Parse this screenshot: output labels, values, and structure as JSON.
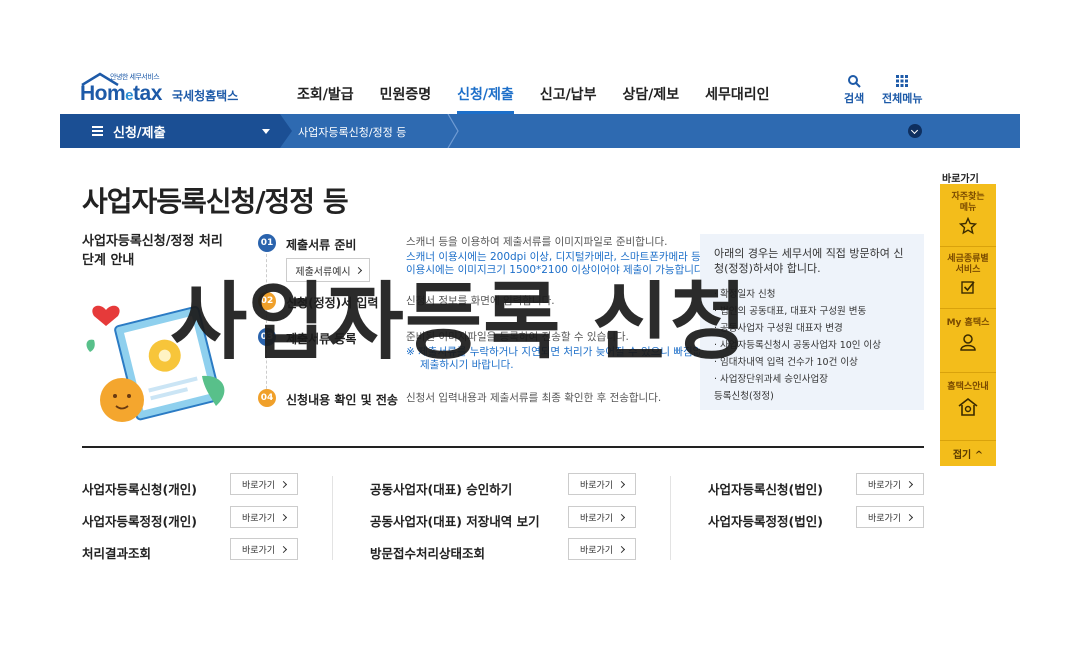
{
  "header": {
    "logo_small": "안녕한 세무서비스",
    "logo_main": "Hometax",
    "logo_sub": "국세청홈택스",
    "nav": [
      "조회/발급",
      "민원증명",
      "신청/제출",
      "신고/납부",
      "상담/제보",
      "세무대리인"
    ],
    "active_nav": "신청/제출",
    "search_label": "검색",
    "menu_label": "전체메뉴"
  },
  "navbar": {
    "category": "신청/제출",
    "current": "사업자등록신청/정정 등"
  },
  "main": {
    "title": "사업자등록신청/정정 등",
    "guide_title": "사업자등록신청/정정 처리단계 안내",
    "steps": [
      {
        "num": "01",
        "title": "제출서류 준비",
        "desc": [
          "스캐너 등을 이용하여 제출서류를 이미지파일로 준비합니다.",
          "스캐너 이용시에는 200dpi 이상, 디지털카메라, 스마트폰카메라 등을",
          "이용시에는 이미지크기 1500*2100 이상이어야 제출이 가능합니다."
        ]
      },
      {
        "num": "02",
        "title": "신청(정정)서 입력",
        "desc": [
          "신청서 정보를 화면에 입력합니다."
        ]
      },
      {
        "num": "03",
        "title": "제출서류 등록",
        "desc": [
          "준비된 이미지파일을 등록하여 전송할 수 있습니다.",
          "※ 제출서류를 누락하거나 지연되면 처리가 늦어질 수 있으니 빠짐없이",
          "제출하시기 바랍니다."
        ]
      },
      {
        "num": "04",
        "title": "신청내용 확인 및 전송",
        "desc": [
          "신청서 입력내용과 제출서류를 최종 확인한 후 전송합니다."
        ]
      }
    ],
    "sample_button": "제출서류예시",
    "notice_title": "아래의 경우는 세무서에 직접 방문하여 신청(정정)하셔야 합니다.",
    "notice_items": [
      "· 확정일자 신청",
      "· 법인의 공동대표, 대표자 구성원 변동",
      "· 공동사업자 구성원 대표자 변경",
      "· 사업자등록신청시 공동사업자 10인 이상",
      "· 임대차내역 입력 건수가 10건 이상",
      "· 사업장단위과세 승인사업장",
      "  등록신청(정정)"
    ],
    "watermark": "사업자등록 신청"
  },
  "links": {
    "go_label": "바로가기",
    "col1": [
      "사업자등록신청(개인)",
      "사업자등록정정(개인)",
      "처리결과조회"
    ],
    "col2": [
      "공동사업자(대표) 승인하기",
      "공동사업자(대표) 저장내역 보기",
      "방문접수처리상태조회"
    ],
    "col3": [
      "사업자등록신청(법인)",
      "사업자등록정정(법인)"
    ]
  },
  "quick": {
    "title": "바로가기",
    "items": [
      "자주찾는 메뉴",
      "세금종류별 서비스",
      "My 홈택스",
      "홈택스안내"
    ],
    "icons": [
      "star-icon",
      "checkbox-icon",
      "person-icon",
      "house-icon"
    ],
    "fold": "접기 ^"
  },
  "colors": {
    "brand_blue": "#1d5aa8",
    "navbar_blue": "#2e6ab1",
    "navbar_dark": "#1b4f94",
    "quick_yellow": "#f3bd1b",
    "step_blue": "#2a63ad",
    "step_orange": "#f0a02a"
  }
}
